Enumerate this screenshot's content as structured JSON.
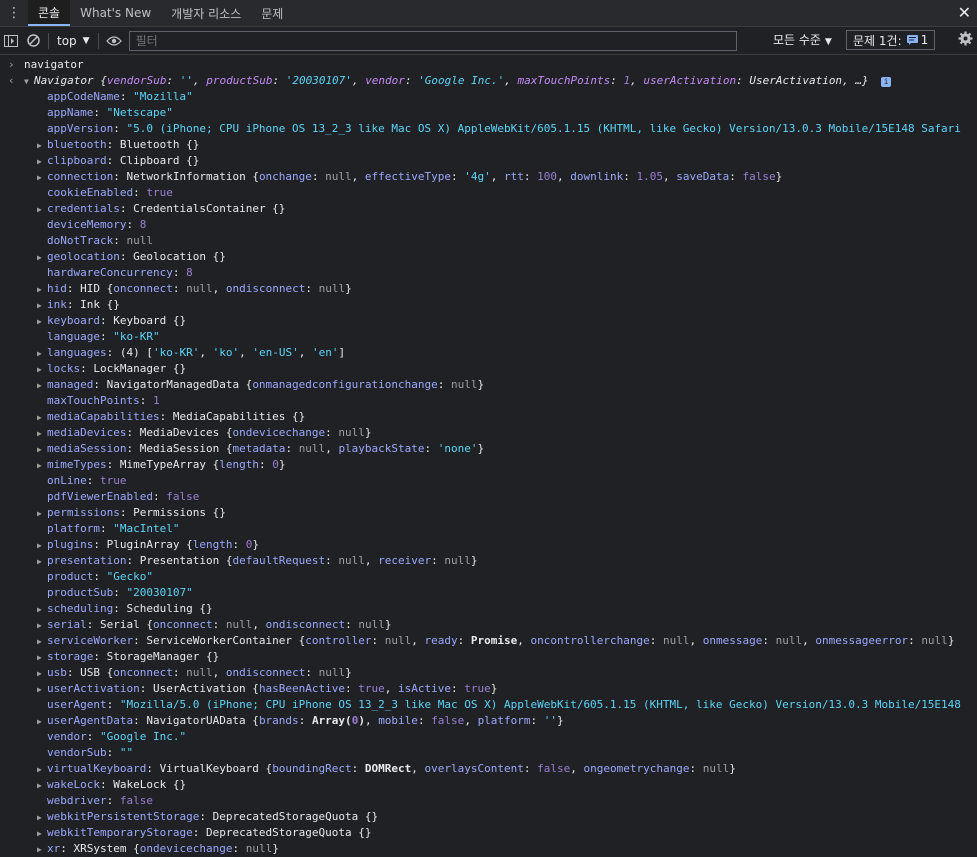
{
  "tabs": [
    "콘솔",
    "What's New",
    "개발자 리소스",
    "문제"
  ],
  "toolbar": {
    "context": "top",
    "filter_placeholder": "필터",
    "levels": "모든 수준",
    "issues_label": "문제 1건:",
    "issues_count": "1"
  },
  "console": {
    "input": "navigator",
    "summary": {
      "name": "Navigator",
      "vendorSub_key": "vendorSub",
      "vendorSub_val": "''",
      "productSub_key": "productSub",
      "productSub_val": "'20030107'",
      "vendor_key": "vendor",
      "vendor_val": "'Google Inc.'",
      "maxTouchPoints_key": "maxTouchPoints",
      "maxTouchPoints_val": "1",
      "userActivation_key": "userActivation",
      "userActivation_val": "UserActivation",
      "ellipsis": "…}"
    },
    "props": [
      {
        "exp": false,
        "key": "appCodeName",
        "val": "\"Mozilla\"",
        "cls": "s"
      },
      {
        "exp": false,
        "key": "appName",
        "val": "\"Netscape\"",
        "cls": "s"
      },
      {
        "exp": false,
        "key": "appVersion",
        "val": "\"5.0 (iPhone; CPU iPhone OS 13_2_3 like Mac OS X) AppleWebKit/605.1.15 (KHTML, like Gecko) Version/13.0.3 Mobile/15E148 Safari",
        "cls": "s"
      },
      {
        "exp": true,
        "key": "bluetooth",
        "val": "Bluetooth {}",
        "cls": "dim"
      },
      {
        "exp": true,
        "key": "clipboard",
        "val": "Clipboard {}",
        "cls": "dim"
      },
      {
        "exp": true,
        "key": "connection",
        "html": "NetworkInformation {onchange: null, effectiveType: '4g', rtt: 100, downlink: 1.05, saveData: false}"
      },
      {
        "exp": false,
        "key": "cookieEnabled",
        "val": "true",
        "cls": "b"
      },
      {
        "exp": true,
        "key": "credentials",
        "val": "CredentialsContainer {}",
        "cls": "dim"
      },
      {
        "exp": false,
        "key": "deviceMemory",
        "val": "8",
        "cls": "n"
      },
      {
        "exp": false,
        "key": "doNotTrack",
        "val": "null",
        "cls": "nl"
      },
      {
        "exp": true,
        "key": "geolocation",
        "val": "Geolocation {}",
        "cls": "dim"
      },
      {
        "exp": false,
        "key": "hardwareConcurrency",
        "val": "8",
        "cls": "n"
      },
      {
        "exp": true,
        "key": "hid",
        "html": "HID {onconnect: null, ondisconnect: null}"
      },
      {
        "exp": true,
        "key": "ink",
        "val": "Ink {}",
        "cls": "dim"
      },
      {
        "exp": true,
        "key": "keyboard",
        "val": "Keyboard {}",
        "cls": "dim"
      },
      {
        "exp": false,
        "key": "language",
        "val": "\"ko-KR\"",
        "cls": "s"
      },
      {
        "exp": true,
        "key": "languages",
        "html": "(4) ['ko-KR', 'ko', 'en-US', 'en']"
      },
      {
        "exp": true,
        "key": "locks",
        "val": "LockManager {}",
        "cls": "dim"
      },
      {
        "exp": true,
        "key": "managed",
        "html": "NavigatorManagedData {onmanagedconfigurationchange: null}"
      },
      {
        "exp": false,
        "key": "maxTouchPoints",
        "val": "1",
        "cls": "n"
      },
      {
        "exp": true,
        "key": "mediaCapabilities",
        "val": "MediaCapabilities {}",
        "cls": "dim"
      },
      {
        "exp": true,
        "key": "mediaDevices",
        "html": "MediaDevices {ondevicechange: null}"
      },
      {
        "exp": true,
        "key": "mediaSession",
        "html": "MediaSession {metadata: null, playbackState: 'none'}"
      },
      {
        "exp": true,
        "key": "mimeTypes",
        "html": "MimeTypeArray {length: 0}"
      },
      {
        "exp": false,
        "key": "onLine",
        "val": "true",
        "cls": "b"
      },
      {
        "exp": false,
        "key": "pdfViewerEnabled",
        "val": "false",
        "cls": "b"
      },
      {
        "exp": true,
        "key": "permissions",
        "val": "Permissions {}",
        "cls": "dim"
      },
      {
        "exp": false,
        "key": "platform",
        "val": "\"MacIntel\"",
        "cls": "s"
      },
      {
        "exp": true,
        "key": "plugins",
        "html": "PluginArray {length: 0}"
      },
      {
        "exp": true,
        "key": "presentation",
        "html": "Presentation {defaultRequest: null, receiver: null}"
      },
      {
        "exp": false,
        "key": "product",
        "val": "\"Gecko\"",
        "cls": "s"
      },
      {
        "exp": false,
        "key": "productSub",
        "val": "\"20030107\"",
        "cls": "s"
      },
      {
        "exp": true,
        "key": "scheduling",
        "val": "Scheduling {}",
        "cls": "dim"
      },
      {
        "exp": true,
        "key": "serial",
        "html": "Serial {onconnect: null, ondisconnect: null}"
      },
      {
        "exp": true,
        "key": "serviceWorker",
        "html": "ServiceWorkerContainer {controller: null, ready: Promise, oncontrollerchange: null, onmessage: null, onmessageerror: null}"
      },
      {
        "exp": true,
        "key": "storage",
        "val": "StorageManager {}",
        "cls": "dim"
      },
      {
        "exp": true,
        "key": "usb",
        "html": "USB {onconnect: null, ondisconnect: null}"
      },
      {
        "exp": true,
        "key": "userActivation",
        "html": "UserActivation {hasBeenActive: true, isActive: true}"
      },
      {
        "exp": false,
        "key": "userAgent",
        "val": "\"Mozilla/5.0 (iPhone; CPU iPhone OS 13_2_3 like Mac OS X) AppleWebKit/605.1.15 (KHTML, like Gecko) Version/13.0.3 Mobile/15E148",
        "cls": "s"
      },
      {
        "exp": true,
        "key": "userAgentData",
        "html": "NavigatorUAData {brands: Array(0), mobile: false, platform: ''}"
      },
      {
        "exp": false,
        "key": "vendor",
        "val": "\"Google Inc.\"",
        "cls": "s"
      },
      {
        "exp": false,
        "key": "vendorSub",
        "val": "\"\"",
        "cls": "s"
      },
      {
        "exp": true,
        "key": "virtualKeyboard",
        "html": "VirtualKeyboard {boundingRect: DOMRect, overlaysContent: false, ongeometrychange: null}"
      },
      {
        "exp": true,
        "key": "wakeLock",
        "val": "WakeLock {}",
        "cls": "dim"
      },
      {
        "exp": false,
        "key": "webdriver",
        "val": "false",
        "cls": "b"
      },
      {
        "exp": true,
        "key": "webkitPersistentStorage",
        "val": "DeprecatedStorageQuota {}",
        "cls": "dim"
      },
      {
        "exp": true,
        "key": "webkitTemporaryStorage",
        "val": "DeprecatedStorageQuota {}",
        "cls": "dim"
      },
      {
        "exp": true,
        "key": "xr",
        "html": "XRSystem {ondevicechange: null}"
      }
    ]
  }
}
